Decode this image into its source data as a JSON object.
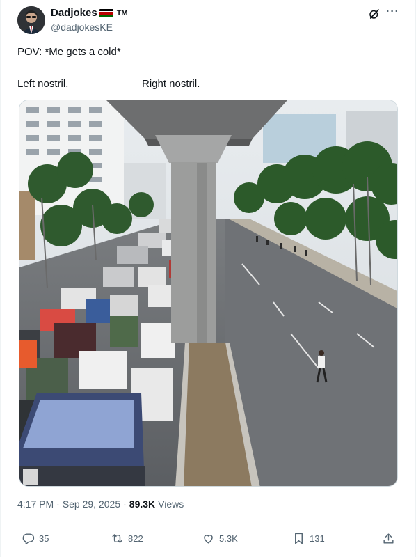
{
  "author": {
    "name": "Dadjokes",
    "tm": "TM",
    "handle": "@dadjokesKE",
    "flag_colors": [
      "#000000",
      "#ffffff",
      "#bb0000",
      "#ffffff",
      "#006600"
    ]
  },
  "icons": {
    "grok": "grok-icon",
    "more": "more-icon"
  },
  "tweet": {
    "text": "POV: *Me gets a cold*",
    "left_label": "Left nostril.",
    "right_label": "Right nostril."
  },
  "meta": {
    "time": "4:17 PM",
    "sep1": "·",
    "date": "Sep 29, 2025",
    "sep2": "·",
    "views_count": "89.3K",
    "views_label": "Views"
  },
  "actions": {
    "replies": "35",
    "reposts": "822",
    "likes": "5.3K",
    "bookmarks": "131"
  },
  "colors": {
    "text": "#0f1419",
    "secondary": "#536471",
    "border": "#eff3f4"
  }
}
